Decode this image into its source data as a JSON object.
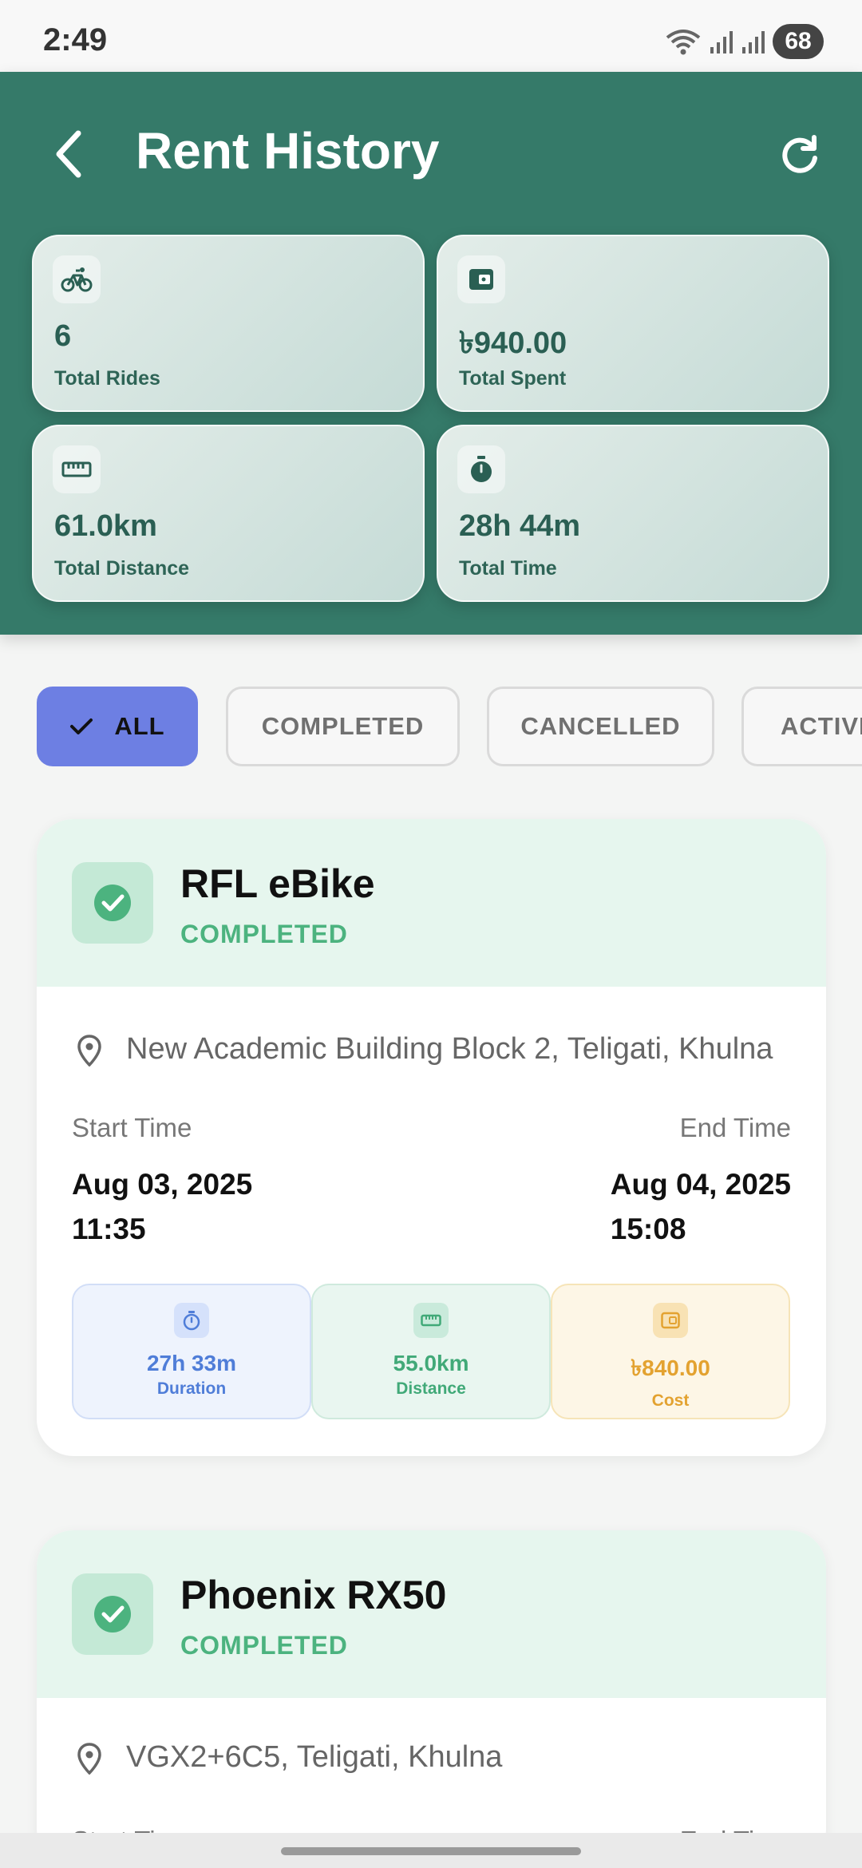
{
  "status_bar": {
    "time": "2:49",
    "battery": "68"
  },
  "header": {
    "title": "Rent History"
  },
  "stats": [
    {
      "icon": "bicycle-icon",
      "value": "6",
      "label": "Total Rides"
    },
    {
      "icon": "wallet-icon",
      "value": "৳940.00",
      "label": "Total Spent"
    },
    {
      "icon": "ruler-icon",
      "value": "61.0km",
      "label": "Total Distance"
    },
    {
      "icon": "timer-icon",
      "value": "28h 44m",
      "label": "Total Time"
    }
  ],
  "filters": {
    "selected": "ALL",
    "items": [
      "ALL",
      "COMPLETED",
      "CANCELLED",
      "ACTIVE"
    ]
  },
  "rentals": [
    {
      "bike": "RFL eBike",
      "status": "COMPLETED",
      "location": "New Academic Building Block 2, Teligati, Khulna",
      "start_label": "Start Time",
      "start_date": "Aug 03, 2025",
      "start_time": "11:35",
      "end_label": "End Time",
      "end_date": "Aug 04, 2025",
      "end_time": "15:08",
      "duration": "27h 33m",
      "duration_label": "Duration",
      "distance": "55.0km",
      "distance_label": "Distance",
      "cost": "৳840.00",
      "cost_label": "Cost"
    },
    {
      "bike": "Phoenix RX50",
      "status": "COMPLETED",
      "location": "VGX2+6C5, Teligati, Khulna",
      "start_label": "Start Time",
      "end_label": "End Time"
    }
  ],
  "colors": {
    "header": "#357a69",
    "chip_active": "#6d7fe3",
    "completed": "#4cb37f",
    "duration": "#4f7dd8",
    "distance": "#41a978",
    "cost": "#e3a230"
  }
}
